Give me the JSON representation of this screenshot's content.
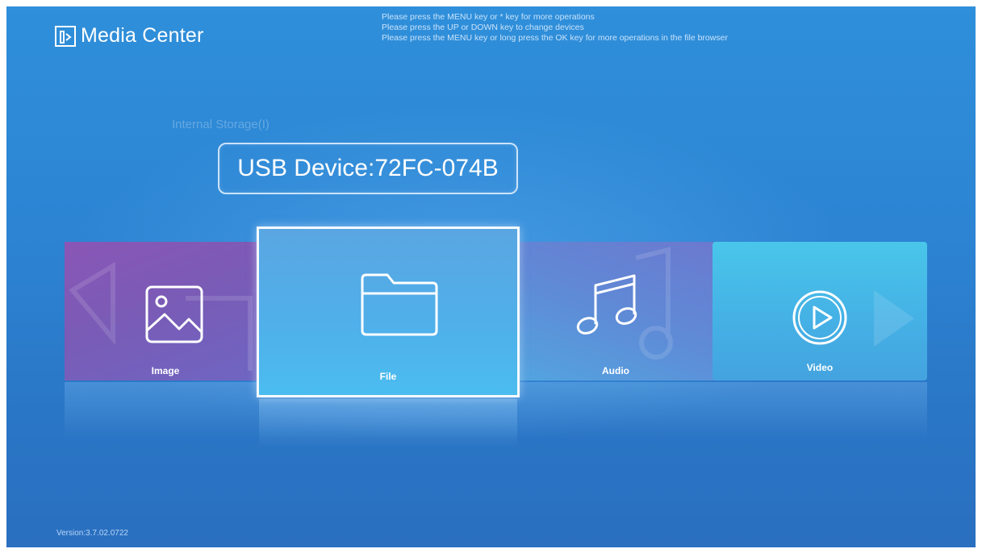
{
  "app": {
    "title": "Media Center",
    "logo_icon": "media-center-logo-icon"
  },
  "hints": [
    "Please press the MENU key or * key for more operations",
    "Please press the UP or DOWN key to change devices",
    "Please press the MENU key or long press the OK key for more operations in the file browser"
  ],
  "devices": {
    "internal": "Internal Storage(I)",
    "selected": "USB Device:72FC-074B"
  },
  "tiles": [
    {
      "label": "Image",
      "icon": "image-icon"
    },
    {
      "label": "File",
      "icon": "folder-icon",
      "selected": true
    },
    {
      "label": "Audio",
      "icon": "music-note-icon"
    },
    {
      "label": "Video",
      "icon": "play-circle-icon"
    }
  ],
  "version": "Version:3.7.02.0722",
  "colors": {
    "background": "#2c83d2",
    "image_tile": "#7a5bb6",
    "file_tile": "#4fb0ea",
    "audio_tile": "#5f8ad6",
    "video_tile": "#45b3e6",
    "selection_border": "#f4faff"
  }
}
